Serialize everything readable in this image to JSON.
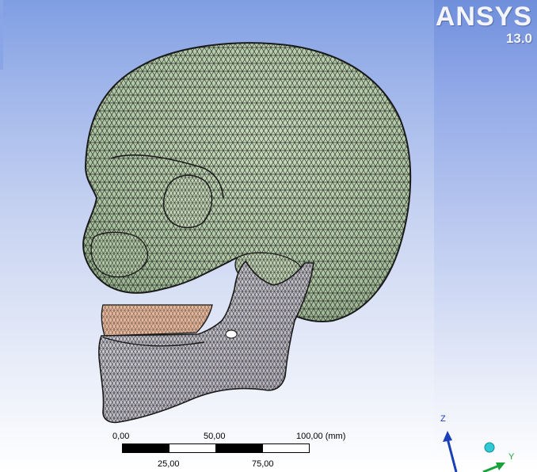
{
  "logo": {
    "brand": "ANSYS",
    "version": "13.0"
  },
  "scale": {
    "top_labels": [
      "0,00",
      "50,00",
      "100,00 (mm)"
    ],
    "bottom_labels": [
      "25,00",
      "75,00"
    ]
  },
  "triad": {
    "z_label": "Z",
    "y_label": "Y"
  },
  "colors": {
    "skull": "#b8d0ad",
    "mesh_line": "#1a1a1a",
    "teeth_upper": "#e9b99c",
    "mandible": "#c9c7cf",
    "axis_z": "#1a3fb8",
    "axis_y": "#1aa33a",
    "axis_ball": "#30c9d6"
  },
  "icons": {
    "triad": "coordinate-triad-icon",
    "model": "skull-mesh-icon"
  }
}
